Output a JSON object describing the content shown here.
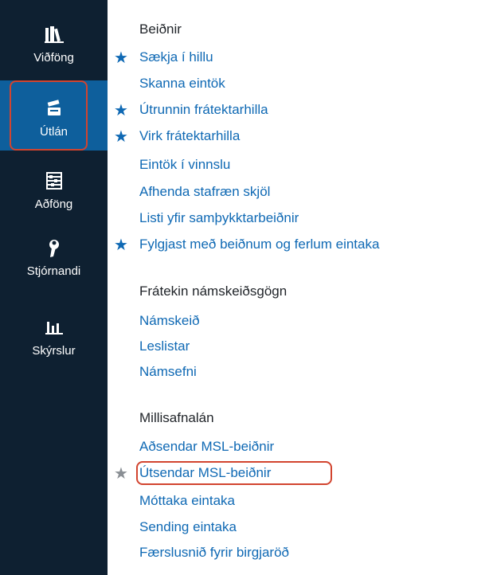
{
  "sidebar": {
    "items": [
      {
        "label": "Viðföng",
        "icon": "library-books-icon"
      },
      {
        "label": "Útlán",
        "icon": "scanner-icon",
        "active": true
      },
      {
        "label": "Aðföng",
        "icon": "abacus-icon"
      },
      {
        "label": "Stjórnandi",
        "icon": "wrench-icon"
      },
      {
        "label": "Skýrslur",
        "icon": "bar-chart-icon"
      }
    ]
  },
  "menu": {
    "section1": {
      "heading": "Beiðnir",
      "items": [
        {
          "label": "Sækja í hillu",
          "starred": true
        },
        {
          "label": "Skanna eintök",
          "starred": false
        },
        {
          "label": "Útrunnin frátektarhilla",
          "starred": true
        },
        {
          "label": "Virk frátektarhilla",
          "starred": true
        },
        {
          "label": "Eintök í vinnslu",
          "starred": false
        },
        {
          "label": "Afhenda stafræn skjöl",
          "starred": false
        },
        {
          "label": "Listi yfir samþykktarbeiðnir",
          "starred": false
        },
        {
          "label": "Fylgjast með beiðnum og ferlum eintaka",
          "starred": true
        }
      ]
    },
    "section2": {
      "heading": "Frátekin námskeiðsgögn",
      "items": [
        {
          "label": "Námskeið"
        },
        {
          "label": "Leslistar"
        },
        {
          "label": "Námsefni"
        }
      ]
    },
    "section3": {
      "heading": "Millisafnalán",
      "items": [
        {
          "label": "Aðsendar MSL-beiðnir",
          "starred": false
        },
        {
          "label": "Útsendar MSL-beiðnir",
          "starred": "grey"
        },
        {
          "label": "Móttaka eintaka",
          "starred": false
        },
        {
          "label": "Sending eintaka",
          "starred": false
        },
        {
          "label": "Færslusnið fyrir birgjaröð",
          "starred": false
        }
      ]
    }
  },
  "colors": {
    "sidebar_bg": "#0e2031",
    "active_bg": "#0e5f9c",
    "link": "#0f69b4",
    "highlight": "#d2442f",
    "grey_star": "#8a8f94"
  },
  "star_glyph": "★"
}
